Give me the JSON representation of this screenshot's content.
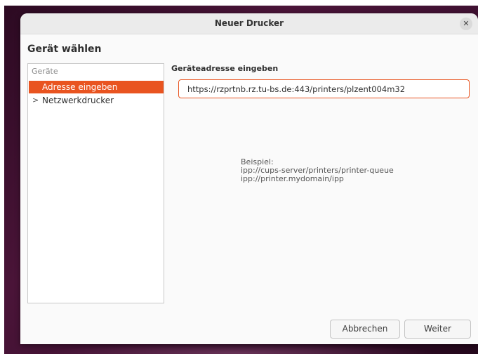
{
  "dialog": {
    "title": "Neuer Drucker",
    "close_icon": "close-icon",
    "heading": "Gerät wählen"
  },
  "devices": {
    "header": "Geräte",
    "items": [
      {
        "label": "Adresse eingeben",
        "selected": true
      },
      {
        "label": "Netzwerkdrucker",
        "expander": "›",
        "selected": false
      }
    ]
  },
  "address": {
    "label": "Geräteadresse eingeben",
    "value": "https://rzprtnb.rz.tu-bs.de:443/printers/plzent004m32",
    "example_title": "Beispiel:",
    "example_lines": [
      "ipp://cups-server/printers/printer-queue",
      "ipp://printer.mydomain/ipp"
    ]
  },
  "buttons": {
    "cancel": "Abbrechen",
    "next": "Weiter"
  },
  "colors": {
    "accent": "#e95420",
    "desktop": "#3a0f2e"
  }
}
